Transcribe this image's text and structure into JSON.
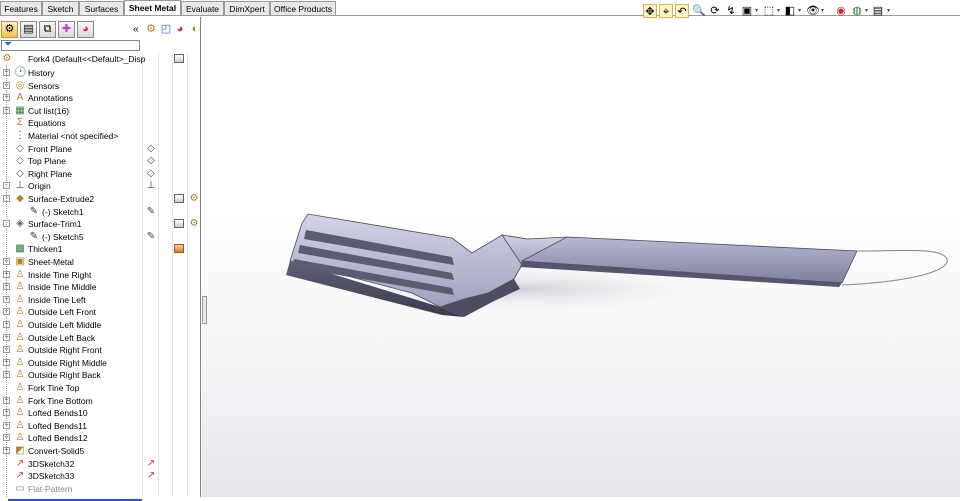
{
  "tabs": [
    "Features",
    "Sketch",
    "Surfaces",
    "Sheet Metal",
    "Evaluate",
    "DimXpert",
    "Office Products"
  ],
  "active_tab": "Sheet Metal",
  "panel": {
    "collapse_glyph": "«",
    "root": "Fork4  (Default<<Default>_Disp",
    "tree": [
      {
        "label": "History",
        "icon": "history-icon"
      },
      {
        "label": "Sensors",
        "icon": "sensors-icon"
      },
      {
        "label": "Annotations",
        "icon": "annotations-icon"
      },
      {
        "label": "Cut list(16)",
        "icon": "cut-list-icon"
      },
      {
        "label": "Equations",
        "icon": "equations-icon"
      },
      {
        "label": "Material <not specified>",
        "icon": "material-icon"
      },
      {
        "label": "Front Plane",
        "icon": "plane-icon"
      },
      {
        "label": "Top Plane",
        "icon": "plane-icon"
      },
      {
        "label": "Right Plane",
        "icon": "plane-icon"
      },
      {
        "label": "Origin",
        "icon": "origin-icon"
      },
      {
        "label": "Surface-Extrude2",
        "icon": "surface-extrude-icon"
      },
      {
        "label": "(-) Sketch1",
        "icon": "sketch-icon"
      },
      {
        "label": "Surface-Trim1",
        "icon": "surface-trim-icon"
      },
      {
        "label": "(-) Sketch5",
        "icon": "sketch-icon"
      },
      {
        "label": "Thicken1",
        "icon": "thicken-icon"
      },
      {
        "label": "Sheet-Metal",
        "icon": "sheet-metal-icon"
      },
      {
        "label": "Inside Tine Right",
        "icon": "lofted-bend-icon"
      },
      {
        "label": "Inside Tine Middle",
        "icon": "lofted-bend-icon"
      },
      {
        "label": "Inside Tine Left",
        "icon": "lofted-bend-icon"
      },
      {
        "label": "Outside Left Front",
        "icon": "lofted-bend-icon"
      },
      {
        "label": "Outside Left Middle",
        "icon": "lofted-bend-icon"
      },
      {
        "label": "Outside Left Back",
        "icon": "lofted-bend-icon"
      },
      {
        "label": "Outside Right Front",
        "icon": "lofted-bend-icon"
      },
      {
        "label": "Outside Right Middle",
        "icon": "lofted-bend-icon"
      },
      {
        "label": "Outside Right Back",
        "icon": "lofted-bend-icon"
      },
      {
        "label": "Fork Tine Top",
        "icon": "lofted-bend-icon"
      },
      {
        "label": "Fork Tine Bottom",
        "icon": "lofted-bend-icon"
      },
      {
        "label": "Lofted Bends10",
        "icon": "lofted-bend-icon"
      },
      {
        "label": "Lofted Bends11",
        "icon": "lofted-bend-icon"
      },
      {
        "label": "Lofted Bends12",
        "icon": "lofted-bend-icon"
      },
      {
        "label": "Convert-Solid5",
        "icon": "convert-solid-icon"
      },
      {
        "label": "3DSketch32",
        "icon": "3d-sketch-icon"
      },
      {
        "label": "3DSketch33",
        "icon": "3d-sketch-icon"
      },
      {
        "label": "Flat-Pattern",
        "icon": "flat-pattern-icon"
      }
    ]
  },
  "colors": {
    "viewport_bottom": "#e6e7ec",
    "selection": "#fdf1c4",
    "rollback_bar": "#3050b8"
  }
}
